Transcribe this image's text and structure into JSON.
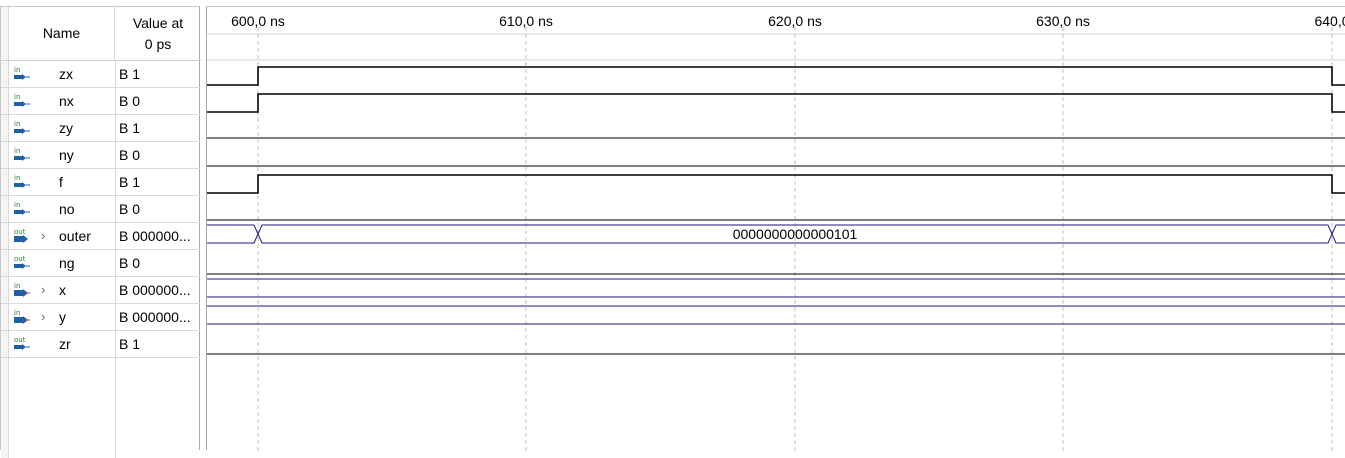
{
  "header": {
    "name_label": "Name",
    "value_label_line1": "Value at",
    "value_label_line2": "0 ps"
  },
  "timeline": {
    "ticks": [
      "600,0 ns",
      "610,0 ns",
      "620,0 ns",
      "630,0 ns",
      "640,0"
    ]
  },
  "signals": [
    {
      "name": "zx",
      "value": "B 1",
      "dir": "in",
      "bus": false
    },
    {
      "name": "nx",
      "value": "B 0",
      "dir": "in",
      "bus": false
    },
    {
      "name": "zy",
      "value": "B 1",
      "dir": "in",
      "bus": false
    },
    {
      "name": "ny",
      "value": "B 0",
      "dir": "in",
      "bus": false
    },
    {
      "name": "f",
      "value": "B 1",
      "dir": "in",
      "bus": false
    },
    {
      "name": "no",
      "value": "B 0",
      "dir": "in",
      "bus": false
    },
    {
      "name": "outer",
      "value": "B 000000...",
      "dir": "out",
      "bus": true
    },
    {
      "name": "ng",
      "value": "B 0",
      "dir": "out",
      "bus": false
    },
    {
      "name": "x",
      "value": "B 000000...",
      "dir": "in",
      "bus": true
    },
    {
      "name": "y",
      "value": "B 000000...",
      "dir": "in",
      "bus": true
    },
    {
      "name": "zr",
      "value": "B 1",
      "dir": "out",
      "bus": false
    }
  ],
  "waves": {
    "outer_value": "0000000000000101"
  },
  "colors": {
    "wave": "#000000",
    "bus": "#1a1a80",
    "grid": "#c0c0c0",
    "icon_in": "#1f5fa8",
    "icon_text": "#2e7d32"
  }
}
